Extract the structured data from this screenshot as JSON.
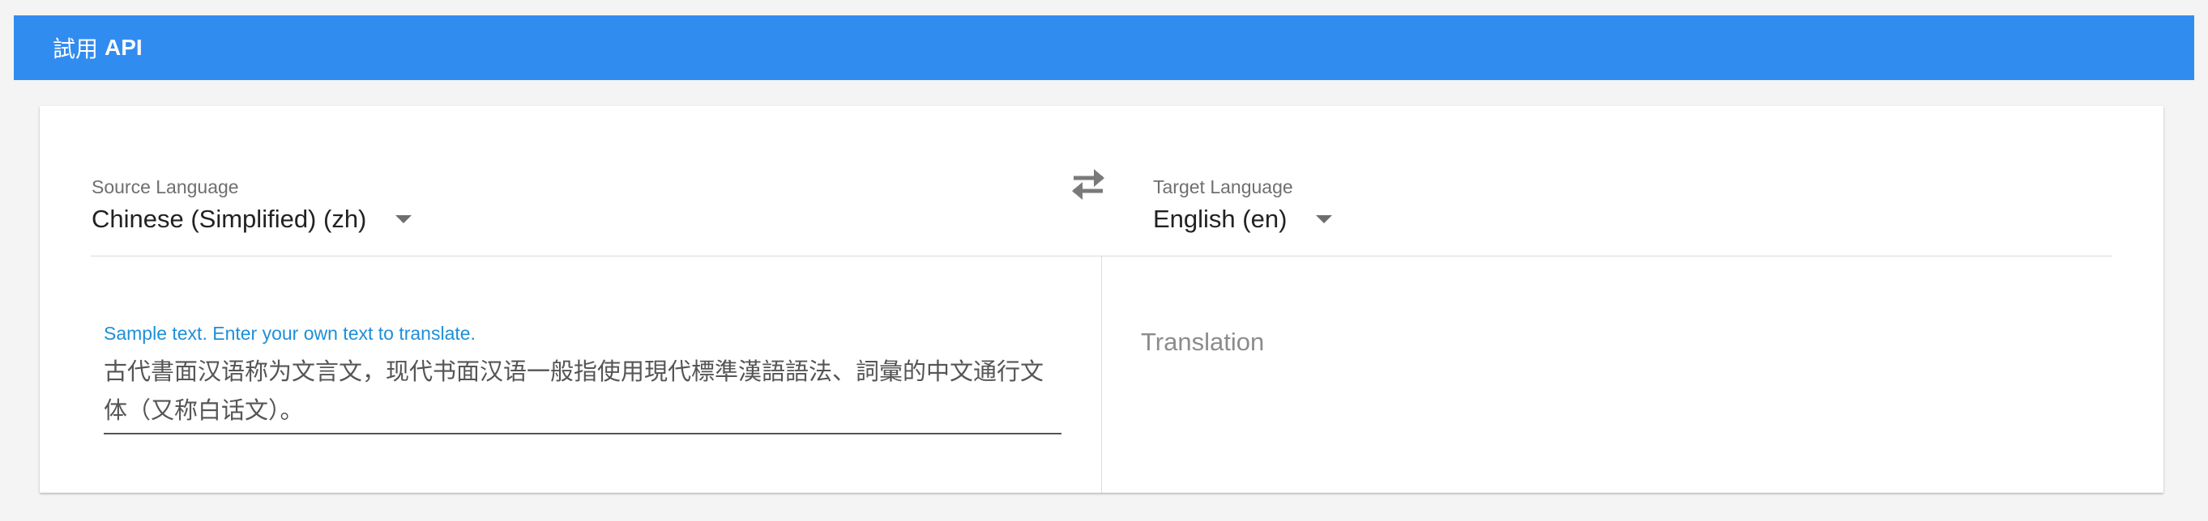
{
  "header": {
    "prefix": "試用",
    "api": "API"
  },
  "source": {
    "label": "Source Language",
    "value": "Chinese (Simplified) (zh)"
  },
  "target": {
    "label": "Target Language",
    "value": "English (en)"
  },
  "input": {
    "hint": "Sample text. Enter your own text to translate.",
    "text": "古代書面汉语称为文言文，现代书面汉语一般指使用現代標準漢語語法、詞彙的中文通行文体（又称白话文）。"
  },
  "output": {
    "placeholder": "Translation"
  },
  "icons": {
    "swap": "swap-icon",
    "dropdown": "chevron-down-icon"
  },
  "colors": {
    "header": "#318cf0",
    "hint": "#1e8fd8"
  }
}
